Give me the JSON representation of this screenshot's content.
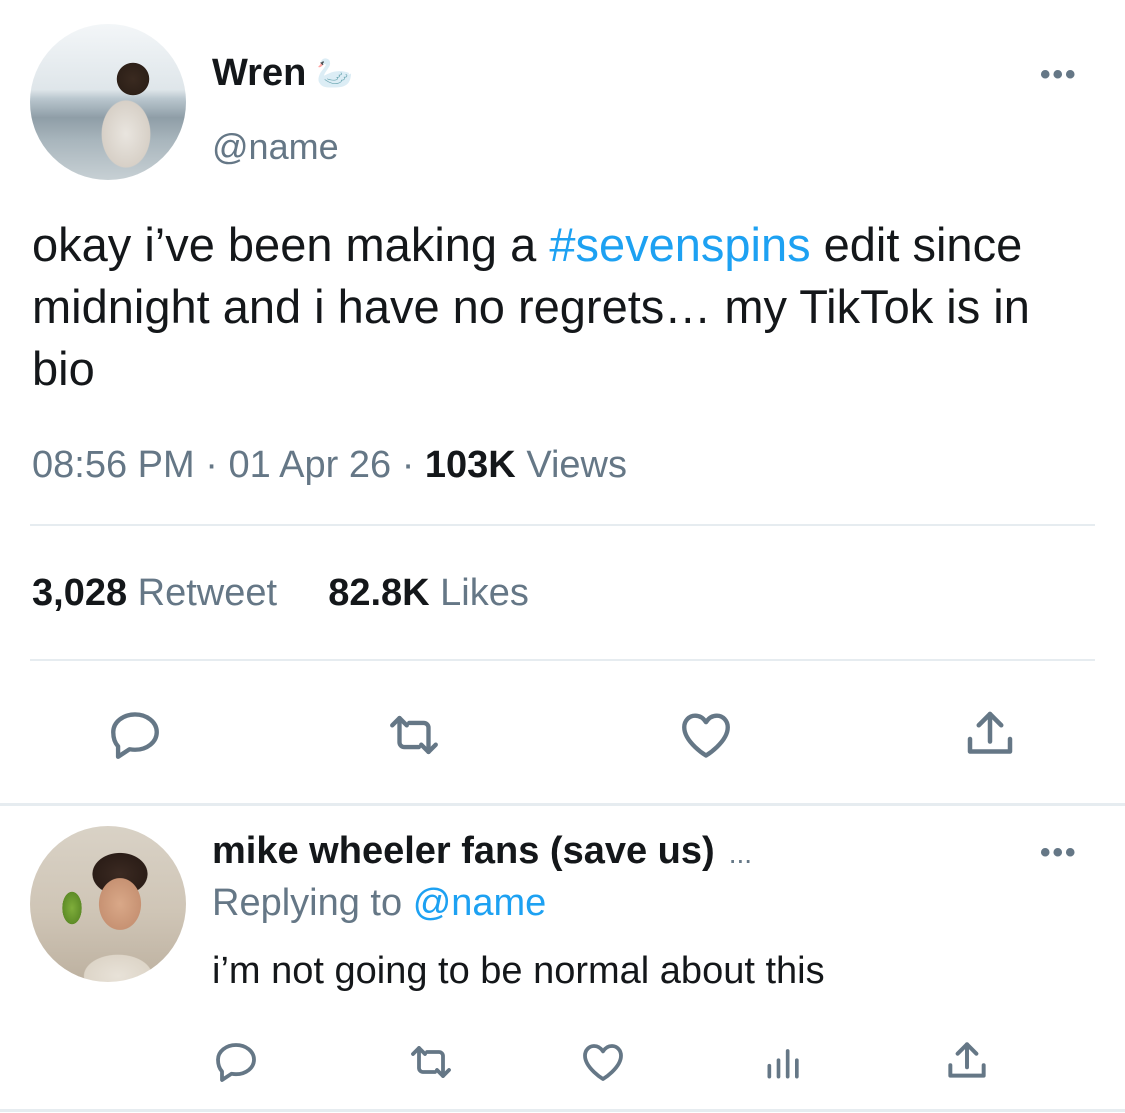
{
  "tweet": {
    "author_name": "Wren",
    "author_emoji": "🦢",
    "author_handle": "@name",
    "text_before": "okay i’ve been making a ",
    "hashtag": "#sevenspins",
    "text_after": " edit since midnight and i have no regrets… my TikTok is in bio",
    "time": "08:56 PM",
    "date": "01 Apr 26",
    "views_count": "103K",
    "views_label": "Views",
    "retweets_count": "3,028",
    "retweets_label": "Retweet",
    "likes_count": "82.8K",
    "likes_label": "Likes",
    "more_label": "•••"
  },
  "reply": {
    "author_name": "mike wheeler fans (save us)",
    "name_ellipsis": "...",
    "replying_prefix": "Replying to",
    "replying_handle": "@name",
    "text": "i’m not going to be normal about this",
    "more_label": "•••"
  },
  "colors": {
    "accent": "#1da1f2",
    "secondary_text": "#657786",
    "primary_text": "#14171a",
    "divider": "#e6ecf0"
  },
  "icons": {
    "tweet_actions": [
      "reply-icon",
      "retweet-icon",
      "like-icon",
      "share-icon"
    ],
    "reply_actions": [
      "reply-icon",
      "retweet-icon",
      "like-icon",
      "analytics-icon",
      "share-icon"
    ]
  }
}
